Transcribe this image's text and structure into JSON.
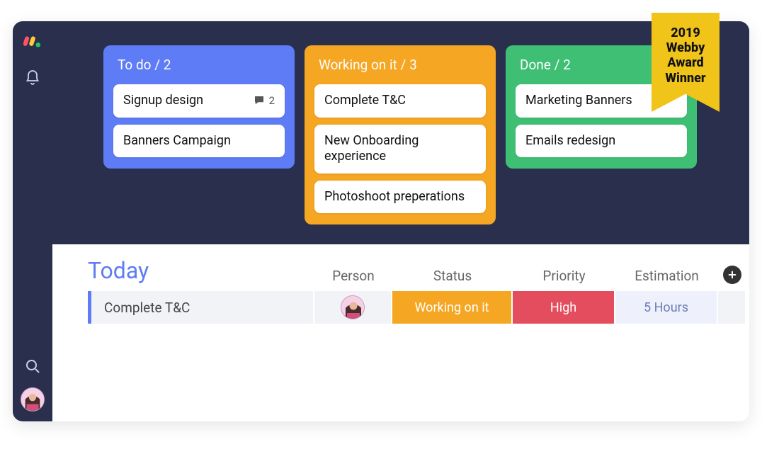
{
  "ribbon": "2019\nWebby\nAward\nWinner",
  "board": {
    "columns": [
      {
        "title": "To do / 2",
        "color": "blue",
        "cards": [
          {
            "title": "Signup design",
            "comments": 2
          },
          {
            "title": "Banners Campaign"
          }
        ]
      },
      {
        "title": "Working on it / 3",
        "color": "orange",
        "cards": [
          {
            "title": "Complete T&C"
          },
          {
            "title": "New Onboarding experience"
          },
          {
            "title": "Photoshoot preperations"
          }
        ]
      },
      {
        "title": "Done / 2",
        "color": "green",
        "cards": [
          {
            "title": "Marketing Banners"
          },
          {
            "title": "Emails redesign"
          }
        ]
      }
    ]
  },
  "table": {
    "group": "Today",
    "headers": {
      "person": "Person",
      "status": "Status",
      "priority": "Priority",
      "estimation": "Estimation"
    },
    "row": {
      "title": "Complete T&C",
      "status": "Working on it",
      "priority": "High",
      "estimation": "5 Hours"
    }
  },
  "icons": {
    "bell": "bell-icon",
    "search": "search-icon",
    "comment": "comment-icon",
    "plus": "plus-icon",
    "logo": "monday-logo",
    "avatar": "user-avatar"
  }
}
